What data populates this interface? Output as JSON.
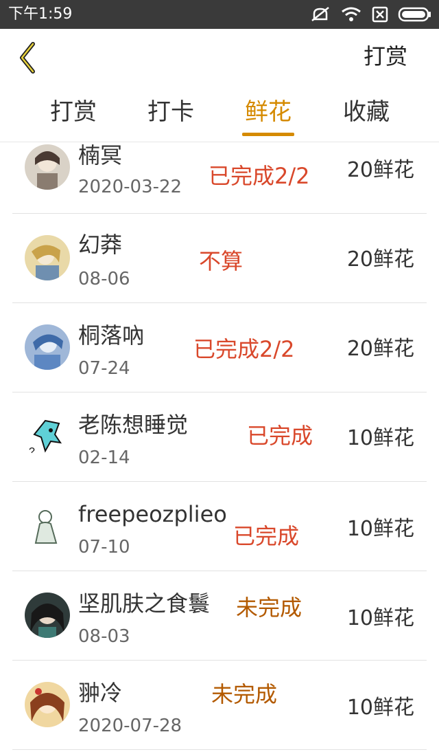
{
  "status_bar": {
    "time": "下午1:59"
  },
  "header": {
    "title": "打赏"
  },
  "tabs": [
    {
      "label": "打赏",
      "active": false
    },
    {
      "label": "打卡",
      "active": false
    },
    {
      "label": "鲜花",
      "active": true
    },
    {
      "label": "收藏",
      "active": false
    }
  ],
  "colors": {
    "accent": "#d58a00",
    "status_done": "#d9482b",
    "status_undone": "#b35a00"
  },
  "list": [
    {
      "name": "楠冥",
      "date": "2020-03-22",
      "status": "已完成2/2",
      "amount": "20鲜花"
    },
    {
      "name": "幻莽",
      "date": "08-06",
      "status": "不算",
      "amount": "20鲜花"
    },
    {
      "name": "桐落吶",
      "date": "07-24",
      "status": "已完成2/2",
      "amount": "20鲜花"
    },
    {
      "name": "老陈想睡觉",
      "date": "02-14",
      "status": "已完成",
      "amount": "10鲜花"
    },
    {
      "name": "freepeozplieo",
      "date": "07-10",
      "status": "已完成",
      "amount": "10鲜花"
    },
    {
      "name": "坚肌肤之食鬟",
      "date": "08-03",
      "status": "未完成",
      "amount": "10鲜花"
    },
    {
      "name": "翀冷",
      "date": "2020-07-28",
      "status": "未完成",
      "amount": "10鲜花"
    }
  ]
}
